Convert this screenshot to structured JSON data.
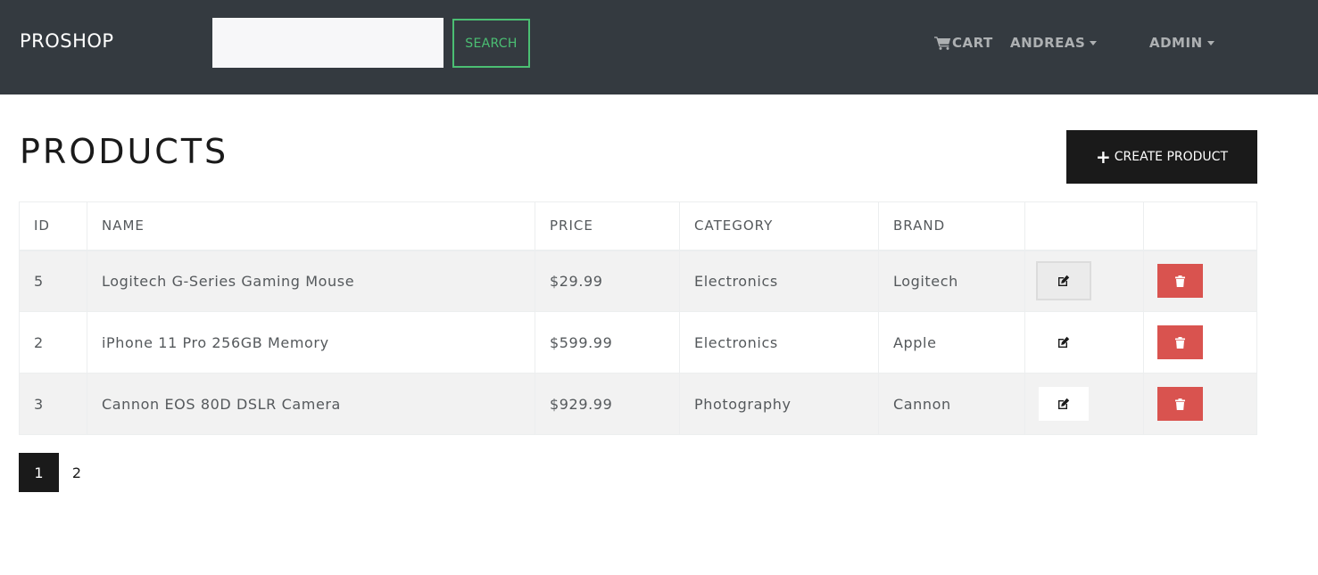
{
  "navbar": {
    "brand": "PROSHOP",
    "search": {
      "value": "",
      "placeholder": ""
    },
    "search_label": "SEARCH",
    "cart_label": "CART",
    "user_label": "ANDREAS",
    "admin_label": "ADMIN"
  },
  "page": {
    "title": "PRODUCTS",
    "create_label": "CREATE PRODUCT"
  },
  "table": {
    "headers": [
      "ID",
      "NAME",
      "PRICE",
      "CATEGORY",
      "BRAND",
      "",
      ""
    ],
    "rows": [
      {
        "id": "5",
        "name": "Logitech G-Series Gaming Mouse",
        "price": "$29.99",
        "category": "Electronics",
        "brand": "Logitech"
      },
      {
        "id": "2",
        "name": "iPhone 11 Pro 256GB Memory",
        "price": "$599.99",
        "category": "Electronics",
        "brand": "Apple"
      },
      {
        "id": "3",
        "name": "Cannon EOS 80D DSLR Camera",
        "price": "$929.99",
        "category": "Photography",
        "brand": "Cannon"
      }
    ]
  },
  "pagination": {
    "pages": [
      "1",
      "2"
    ],
    "active": "1"
  },
  "icons": {
    "cart": "shopping-cart-icon",
    "edit": "edit-icon",
    "delete": "trash-icon",
    "plus": "plus-icon",
    "caret": "caret-down-icon"
  },
  "colors": {
    "navbar": "#343a40",
    "accent_green": "#4bbf73",
    "danger": "#d9534f",
    "primary_dark": "#1a1a1a",
    "stripe": "#f2f2f2"
  }
}
